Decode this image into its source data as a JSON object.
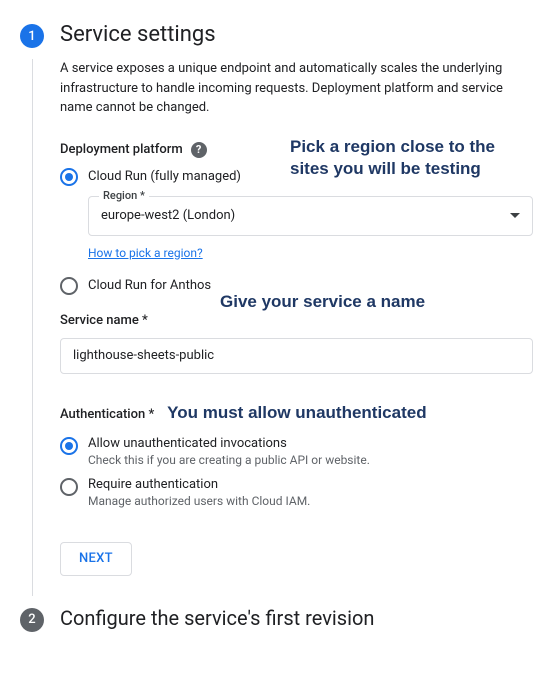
{
  "step1": {
    "number": "1",
    "title": "Service settings",
    "description": "A service exposes a unique endpoint and automatically scales the underlying infrastructure to handle incoming requests. Deployment platform and service name cannot be changed.",
    "deployment": {
      "label": "Deployment platform",
      "annotation": "Pick a region close to the sites you will be testing",
      "option_managed": "Cloud Run (fully managed)",
      "option_anthos": "Cloud Run for Anthos",
      "region_legend": "Region *",
      "region_value": "europe-west2 (London)",
      "region_help_link": "How to pick a region?"
    },
    "service_name": {
      "annotation": "Give your service a name",
      "label": "Service name *",
      "value": "lighthouse-sheets-public"
    },
    "auth": {
      "label": "Authentication *",
      "annotation": "You must allow unauthenticated",
      "allow_label": "Allow unauthenticated invocations",
      "allow_sub": "Check this if you are creating a public API or website.",
      "require_label": "Require authentication",
      "require_sub": "Manage authorized users with Cloud IAM."
    },
    "next": "NEXT"
  },
  "step2": {
    "number": "2",
    "title": "Configure the service's first revision"
  }
}
